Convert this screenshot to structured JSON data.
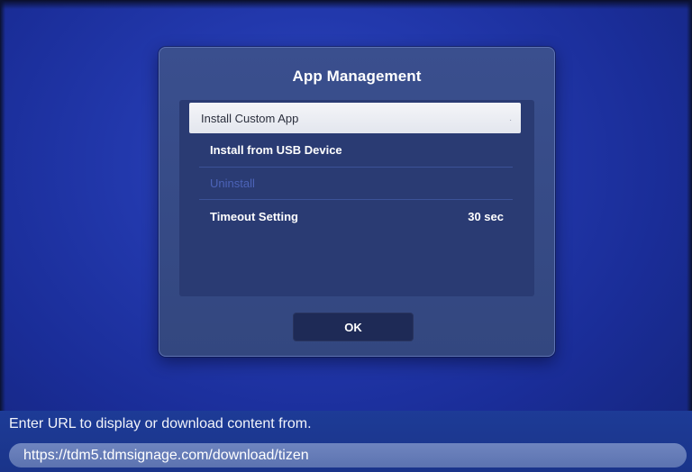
{
  "dialog": {
    "title": "App Management",
    "items": [
      {
        "label": "Install Custom App",
        "value": "",
        "state": "selected"
      },
      {
        "label": "Install from USB Device",
        "value": "",
        "state": "normal"
      },
      {
        "label": "Uninstall",
        "value": "",
        "state": "disabled"
      },
      {
        "label": "Timeout Setting",
        "value": "30 sec",
        "state": "normal"
      }
    ],
    "ok_label": "OK"
  },
  "footer": {
    "caption": "Enter URL to display or download content from.",
    "url_value": "https://tdm5.tdmsignage.com/download/tizen"
  },
  "colors": {
    "background": "#2238ac",
    "dialog": "#3a4f8e",
    "selected_item": "#f4f5f8",
    "disabled_text": "#4c63b8",
    "url_field": "#6f85bf"
  }
}
